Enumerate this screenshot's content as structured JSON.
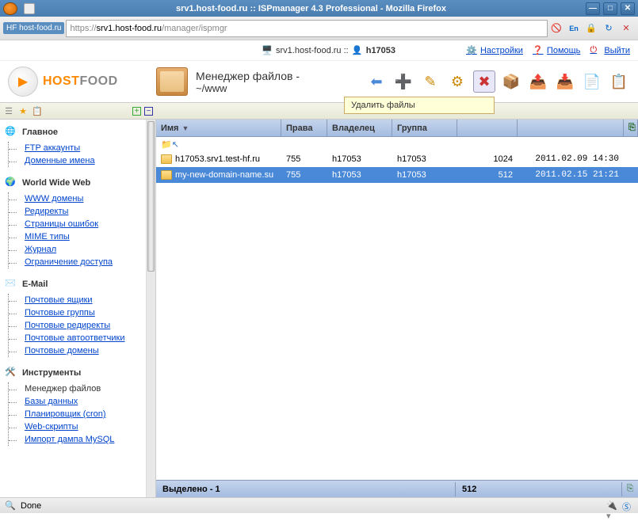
{
  "window": {
    "title": "srv1.host-food.ru :: ISPmanager 4.3 Professional - Mozilla Firefox"
  },
  "browser": {
    "site_badge": "HF host-food.ru",
    "url_proto": "https://",
    "url_host": "srv1.host-food.ru",
    "url_path": "/manager/ispmgr",
    "done": "Done",
    "lang_flag": "En"
  },
  "userbar": {
    "server": "srv1.host-food.ru ::",
    "user": "h17053",
    "settings": "Настройки",
    "help": "Помощь",
    "exit": "Выйти"
  },
  "logo": {
    "part1": "HOST",
    "part2": "FOOD"
  },
  "filemanager": {
    "title": "Менеджер файлов -",
    "path": "~/www",
    "tooltip": "Удалить файлы"
  },
  "columns": {
    "name": "Имя",
    "perm": "Права",
    "owner": "Владелец",
    "group": "Группа",
    "size": "",
    "date": ""
  },
  "rows": [
    {
      "name": "h17053.srv1.test-hf.ru",
      "perm": "755",
      "owner": "h17053",
      "group": "h17053",
      "size": "1024",
      "date": "2011.02.09 14:30",
      "selected": false
    },
    {
      "name": "my-new-domain-name.su",
      "perm": "755",
      "owner": "h17053",
      "group": "h17053",
      "size": "512",
      "date": "2011.02.15 21:21",
      "selected": true
    }
  ],
  "status": {
    "selected": "Выделено - 1",
    "size": "512"
  },
  "sidebar": {
    "main": {
      "label": "Главное",
      "items": [
        "FTP аккаунты",
        "Доменные имена"
      ]
    },
    "www": {
      "label": "World Wide Web",
      "items": [
        "WWW домены",
        "Редиректы",
        "Страницы ошибок",
        "MIME типы",
        "Журнал",
        "Ограничение доступа"
      ]
    },
    "email": {
      "label": "E-Mail",
      "items": [
        "Почтовые ящики",
        "Почтовые группы",
        "Почтовые редиректы",
        "Почтовые автоответчики",
        "Почтовые домены"
      ]
    },
    "tools": {
      "label": "Инструменты",
      "items": [
        "Менеджер файлов",
        "Базы данных",
        "Планировщик (cron)",
        "Web-скрипты",
        "Импорт дампа MySQL"
      ]
    }
  }
}
